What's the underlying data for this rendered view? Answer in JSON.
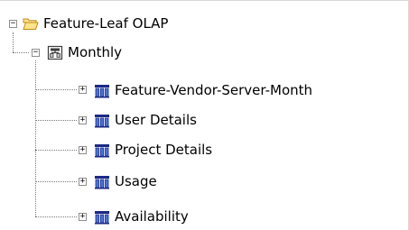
{
  "tree": {
    "root": {
      "label": "Feature-Leaf OLAP",
      "expander": "−",
      "icon": "folder-open-icon",
      "children": [
        {
          "label": "Monthly",
          "expander": "−",
          "icon": "hierarchy-icon",
          "children": [
            {
              "label": "Feature-Vendor-Server-Month",
              "expander": "+",
              "icon": "cube-icon"
            },
            {
              "label": "User Details",
              "expander": "+",
              "icon": "cube-icon"
            },
            {
              "label": "Project Details",
              "expander": "+",
              "icon": "cube-icon"
            },
            {
              "label": "Usage",
              "expander": "+",
              "icon": "cube-icon"
            },
            {
              "label": "Availability",
              "expander": "+",
              "icon": "cube-icon"
            }
          ]
        }
      ]
    }
  },
  "colors": {
    "folder_fill": "#fde38a",
    "folder_stroke": "#c08a14",
    "cube_dark": "#1b2a86",
    "cube_blue": "#4a73d6",
    "hierarchy_stroke": "#3c3c3c"
  }
}
